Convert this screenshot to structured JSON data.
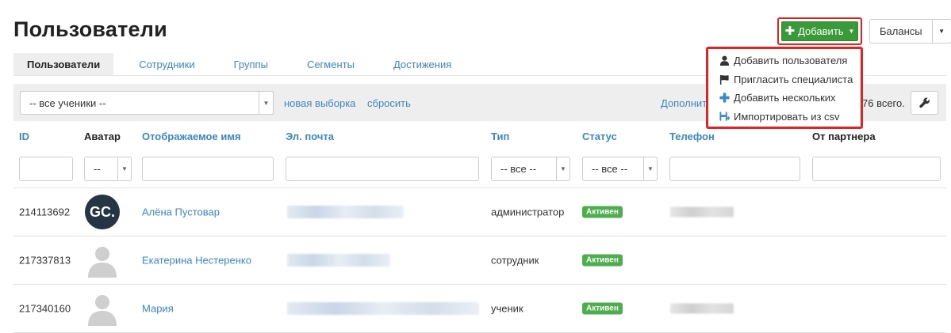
{
  "page": {
    "title": "Пользователи"
  },
  "toolbar": {
    "add_label": "Добавить",
    "balances_label": "Балансы"
  },
  "add_menu": {
    "items": [
      {
        "label": "Добавить пользователя",
        "icon": "user-icon"
      },
      {
        "label": "Пригласить специалиста",
        "icon": "flag-icon"
      },
      {
        "label": "Добавить нескольких",
        "icon": "plus-icon"
      },
      {
        "label": "Импортировать из csv",
        "icon": "import-icon"
      }
    ]
  },
  "tabs": [
    {
      "label": "Пользователи",
      "active": true
    },
    {
      "label": "Сотрудники"
    },
    {
      "label": "Группы"
    },
    {
      "label": "Сегменты"
    },
    {
      "label": "Достижения"
    }
  ],
  "filter_bar": {
    "segment_value": "-- все ученики --",
    "new_selection": "новая выборка",
    "reset": "сбросить",
    "more": "Дополнит",
    "total": "76 всего."
  },
  "table": {
    "headers": {
      "id": "ID",
      "avatar": "Аватар",
      "display_name": "Отображаемое имя",
      "email": "Эл. почта",
      "type": "Тип",
      "status": "Статус",
      "phone": "Телефон",
      "partner": "От партнера"
    },
    "filters": {
      "avatar_value": "--",
      "type_value": "-- все --",
      "status_value": "-- все --"
    },
    "rows": [
      {
        "id": "214113692",
        "avatar_text": "GC.",
        "name": "Алёна Пустовар",
        "type": "администратор",
        "status": "Активен"
      },
      {
        "id": "217337813",
        "name": "Екатерина Нестеренко",
        "type": "сотрудник",
        "status": "Активен"
      },
      {
        "id": "217340160",
        "name": "Мария",
        "type": "ученик",
        "status": "Активен"
      }
    ]
  },
  "colors": {
    "accent": "#3d87c4",
    "primary_button": "#3a9a3a",
    "badge": "#4cae4c",
    "highlight": "#e02424"
  }
}
